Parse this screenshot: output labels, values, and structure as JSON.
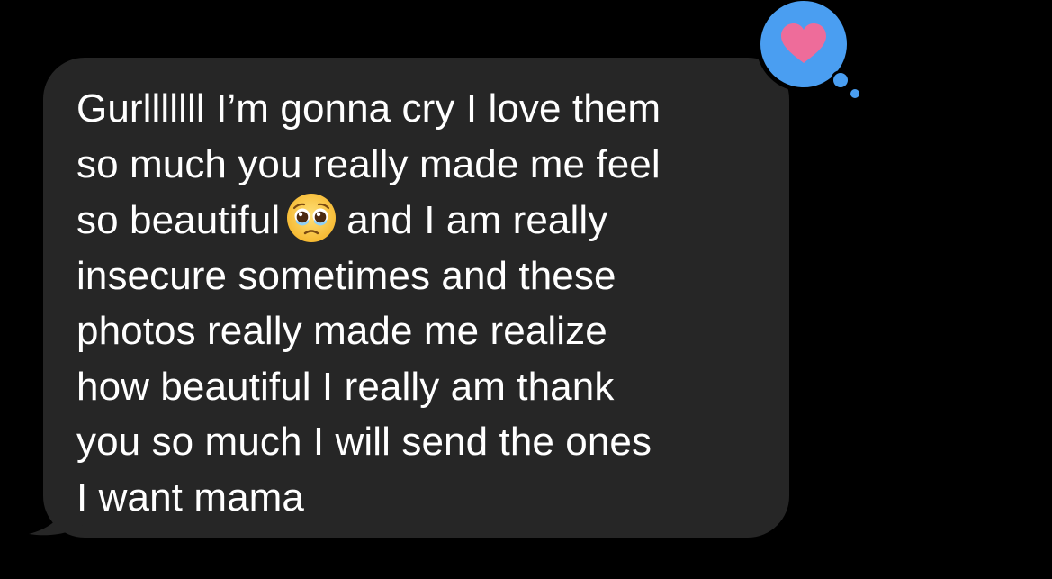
{
  "message": {
    "direction": "received",
    "lines": [
      "Gurlllllll I’m gonna cry I love them",
      "so much you really made me feel",
      [
        "so beautiful",
        "and I am really"
      ],
      "insecure sometimes and these",
      "photos really made me realize",
      "how beautiful I really am thank",
      "you so much I will send the ones",
      "I want mama"
    ],
    "inline_emoji": "pleading-face-icon"
  },
  "reaction": {
    "type": "heart",
    "icon": "heart-icon"
  },
  "colors": {
    "background": "#000000",
    "bubble": "#262626",
    "text": "#ffffff",
    "tapback": "#4a9ef1",
    "heart": "#ee6c9a"
  }
}
